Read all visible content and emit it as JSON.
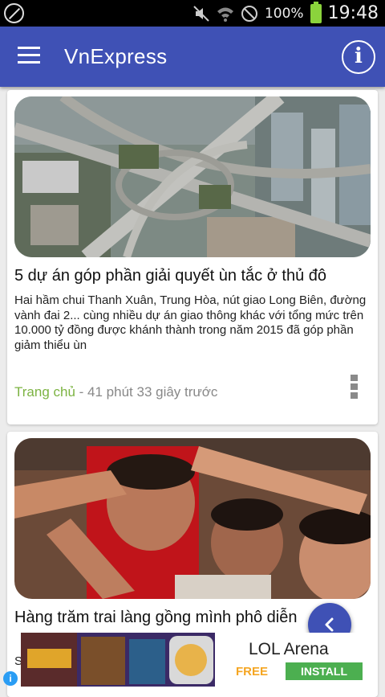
{
  "status_bar": {
    "battery_percent": "100%",
    "time": "19:48",
    "icons": [
      "blocked-icon",
      "mute-icon",
      "wifi-icon",
      "no-entry-icon",
      "battery-icon"
    ]
  },
  "app_bar": {
    "title": "VnExpress",
    "menu_icon": "menu-icon",
    "info_icon": "info-icon",
    "color": "#3f51b5"
  },
  "articles": [
    {
      "image_subject": "aerial view of highway interchange",
      "headline": "5 dự án góp phần giải quyết ùn tắc ở thủ đô",
      "summary": "Hai hầm chui Thanh Xuân, Trung Hòa, nút giao Long Biên, đường vành đai 2... cùng nhiều dự án giao thông khác với tổng mức trên 10.000 tỷ đồng được khánh thành trong năm 2015 đã góp phần giảm thiểu ùn",
      "category": "Trang chủ",
      "time_ago": "- 41 phút 33 giây trước"
    },
    {
      "image_subject": "crowd of men at village festival",
      "headline": "Hàng trăm trai làng gồng mình phô diễn",
      "summary": "S",
      "category": "",
      "time_ago": ""
    }
  ],
  "fab": {
    "icon": "chevron-left-icon"
  },
  "ad": {
    "title": "LOL Arena",
    "free_label": "FREE",
    "install_label": "INSTALL",
    "info_icon": "ad-info-icon"
  }
}
